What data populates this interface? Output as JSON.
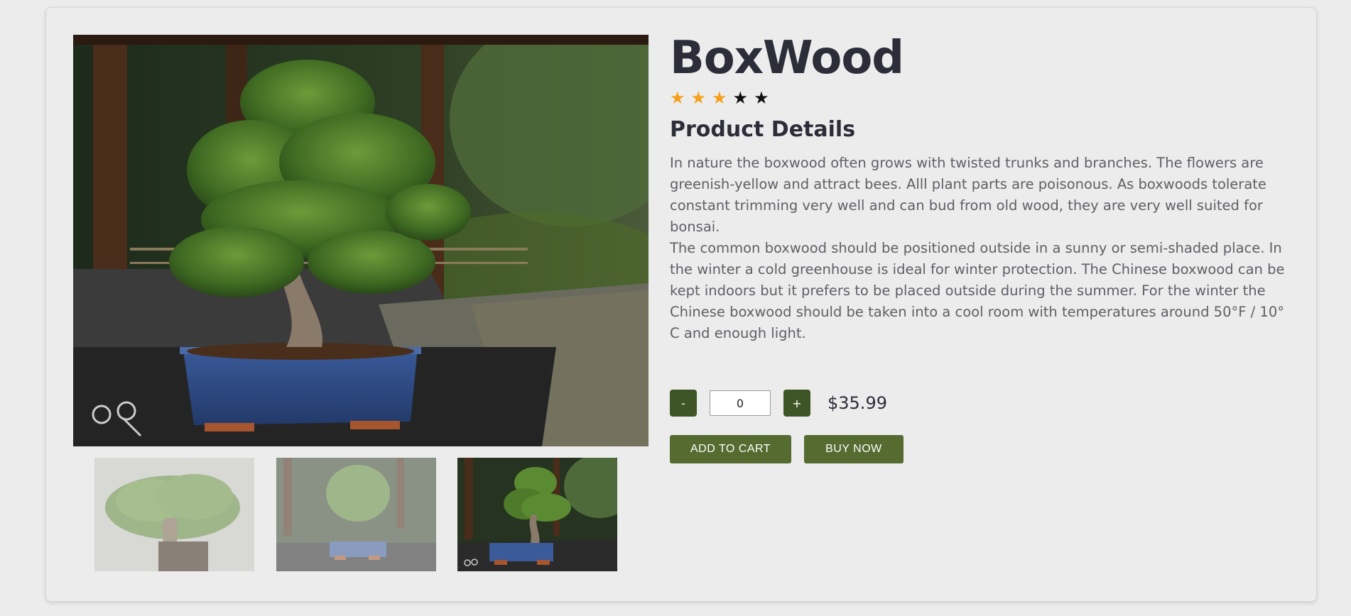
{
  "product": {
    "name": "BoxWood",
    "rating": 3,
    "rating_max": 5,
    "details_heading": "Product Details",
    "description": [
      "In nature the boxwood often grows with twisted trunks and branches. The flowers are greenish-yellow and attract bees. Alll plant parts are poisonous. As boxwoods tolerate constant trimming very well and can bud from old wood, they are very well suited for bonsai.",
      "The common boxwood should be positioned outside in a sunny or semi-shaded place. In the winter a cold greenhouse is ideal for winter protection. The Chinese boxwood can be kept indoors but it prefers to be placed outside during the summer. For the winter the Chinese boxwood should be taken into a cool room with temperatures around 50°F / 10° C and enough light."
    ],
    "price": "$35.99"
  },
  "quantity": {
    "decrement_label": "-",
    "increment_label": "+",
    "value": "0"
  },
  "actions": {
    "add_to_cart": "ADD TO CART",
    "buy_now": "BUY NOW"
  },
  "gallery": {
    "selected_index": 2,
    "thumbnail_count": 3
  },
  "colors": {
    "star_on": "#f5a01a",
    "star_off": "#111111",
    "qty_button": "#3e5626",
    "action_button": "#556b2f",
    "title_text": "#2d2d3a"
  },
  "icons": {
    "star": "star-icon"
  }
}
